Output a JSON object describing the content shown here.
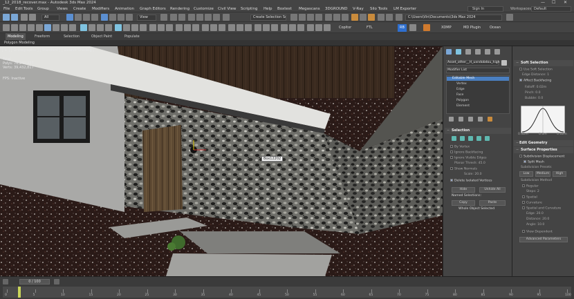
{
  "titlebar": {
    "title": "_12_2018_recover.max - Autodesk 3ds Max 2024",
    "minimize": "—",
    "maximize": "☐",
    "close": "✕"
  },
  "menubar": {
    "items": [
      "File",
      "Edit",
      "Tools",
      "Group",
      "Views",
      "Create",
      "Modifiers",
      "Animation",
      "Graph Editors",
      "Rendering",
      "Customize",
      "Civil View",
      "Scripting",
      "Help",
      "Boxtest",
      "Megascans",
      "3DGROUND",
      "V-Ray",
      "Silo Tools",
      "LM Exporter"
    ],
    "sign_in": "Sign In",
    "workspaces_label": "Workspaces:",
    "workspace_value": "Default"
  },
  "toolbar1": {
    "filter": "All",
    "view": "View",
    "selection_set": "Create Selection Se",
    "path": "C:\\Users\\Vin\\Documents\\3ds Max 2024"
  },
  "toolbar2": {
    "buttons": [
      "Copitor",
      "FTL",
      "RB",
      "XDMP",
      "MD Plugin",
      "Ocean"
    ]
  },
  "ribbon": {
    "tabs": [
      "Modeling",
      "Freeform",
      "Selection",
      "Object Paint",
      "Populate"
    ],
    "sub": "Polygon Modeling"
  },
  "viewport": {
    "label": "[ + ] [ Orthographic ] [ Standard ] [ Default Shading ]",
    "stats": [
      "Total",
      "Polys: 76,241,277",
      "Verts: 39,432,817"
    ],
    "fps": "FPS: Inactive",
    "tooltip": "Box12202"
  },
  "command_panel": {
    "object_name": "Asset_other__H_uxndobdou_high",
    "modifier_list": "Modifier List",
    "stack": [
      "Editable Mesh",
      "Vertex",
      "Edge",
      "Face",
      "Polygon",
      "Element"
    ],
    "selection": {
      "title": "Selection",
      "options": [
        "By Vertex",
        "Ignore Backfacing",
        "Ignore Visible Edges",
        "Planar Thresh: 45.0",
        "Show Normals",
        "Scale: 20.0",
        "Delete Isolated Vertices"
      ],
      "buttons": [
        "Hide",
        "Unhide All"
      ],
      "named_label": "Named Selections:",
      "named_buttons": [
        "Copy",
        "Paste"
      ],
      "status": "Whole Object Selected"
    }
  },
  "properties": {
    "soft_selection": {
      "title": "Soft Selection",
      "options": [
        "Use Soft Selection",
        "Edge Distance: 1",
        "Affect Backfacing",
        "Falloff: 0.02m",
        "Pinch: 0.0",
        "Bubble: 0.0"
      ],
      "curve_labels": [
        "0.02m",
        "0.0m",
        "0.02m"
      ]
    },
    "edit_geometry": {
      "title": "Edit Geometry"
    },
    "surface_properties": {
      "title": "Surface Properties",
      "options": [
        "Subdivision Displacement",
        "Split Mesh"
      ],
      "presets_label": "Subdivision Presets",
      "presets": [
        "Low",
        "Medium",
        "High"
      ],
      "method_label": "Subdivision Method",
      "methods": [
        "Regular",
        "Steps: 2",
        "Spatial",
        "Curvature",
        "Spatial and Curvature",
        "Edge: 20.0",
        "Distance: 20.0",
        "Angle: 10.0",
        "View Dependent"
      ],
      "advanced": "Advanced Parameters"
    }
  },
  "timeline": {
    "frame": "0 / 100",
    "ticks": [
      "0",
      "5",
      "10",
      "15",
      "20",
      "25",
      "30",
      "35",
      "40",
      "45",
      "50",
      "55",
      "60",
      "65",
      "70",
      "75",
      "80",
      "85",
      "90",
      "95",
      "100"
    ]
  }
}
